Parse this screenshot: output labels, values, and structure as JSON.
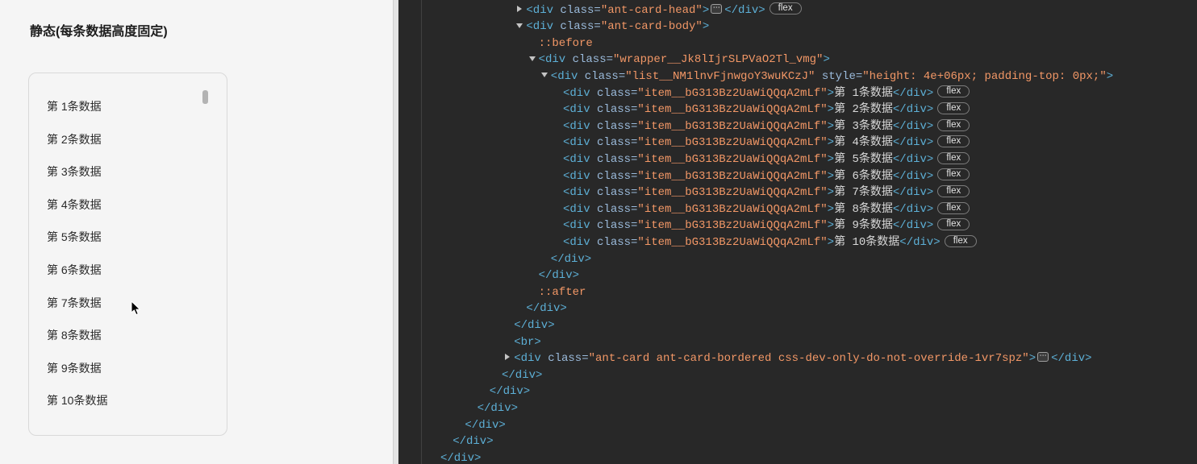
{
  "left_panel": {
    "title": "静态(每条数据高度固定)",
    "list": {
      "scroll_fraction": 0,
      "items": [
        "第 1条数据",
        "第 2条数据",
        "第 3条数据",
        "第 4条数据",
        "第 5条数据",
        "第 6条数据",
        "第 7条数据",
        "第 8条数据",
        "第 9条数据",
        "第 10条数据"
      ]
    }
  },
  "devtools": {
    "colors": {
      "background": "#282828",
      "tag": "#5db0d7",
      "attribute_name": "#9bbbdc",
      "attribute_value": "#f29766",
      "pseudo_element": "#f29766",
      "text": "#d9d9d9",
      "toggle": "#c4c4c4"
    },
    "lines": [
      {
        "toggle": "collapsed-triangle-icon",
        "tokens": [
          {
            "tag": "<div"
          },
          {
            "attr": " class="
          },
          {
            "value": "\"ant-card-head\""
          },
          {
            "tag": ">"
          },
          {
            "ellipsis": "⋯"
          },
          {
            "tag": "</div>"
          },
          {
            "badge": "flex"
          }
        ]
      },
      {
        "toggle": "expanded-triangle-icon",
        "tokens": [
          {
            "tag": "<div"
          },
          {
            "attr": " class="
          },
          {
            "value": "\"ant-card-body\""
          },
          {
            "tag": ">"
          }
        ]
      },
      {
        "tokens": [
          {
            "pseudo": "::before"
          }
        ]
      },
      {
        "toggle": "expanded-triangle-icon",
        "tokens": [
          {
            "tag": "<div"
          },
          {
            "attr": " class="
          },
          {
            "value": "\"wrapper__Jk8lIjrSLPVaO2Tl_vmg\""
          },
          {
            "tag": ">"
          }
        ]
      },
      {
        "toggle": "expanded-triangle-icon",
        "tokens": [
          {
            "tag": "<div"
          },
          {
            "attr": " class="
          },
          {
            "value": "\"list__NM1lnvFjnwgoY3wuKCzJ\""
          },
          {
            "attr": " style="
          },
          {
            "value": "\"height: 4e+06px; padding-top: 0px;\""
          },
          {
            "tag": ">"
          }
        ]
      },
      {
        "tokens": [
          {
            "tag": "<div"
          },
          {
            "attr": " class="
          },
          {
            "value": "\"item__bG313Bz2UaWiQQqA2mLf\""
          },
          {
            "tag": ">"
          },
          {
            "text": "第 1条数据"
          },
          {
            "tag": "</div>"
          },
          {
            "badge": "flex"
          }
        ]
      },
      {
        "tokens": [
          {
            "tag": "<div"
          },
          {
            "attr": " class="
          },
          {
            "value": "\"item__bG313Bz2UaWiQQqA2mLf\""
          },
          {
            "tag": ">"
          },
          {
            "text": "第 2条数据"
          },
          {
            "tag": "</div>"
          },
          {
            "badge": "flex"
          }
        ]
      },
      {
        "tokens": [
          {
            "tag": "<div"
          },
          {
            "attr": " class="
          },
          {
            "value": "\"item__bG313Bz2UaWiQQqA2mLf\""
          },
          {
            "tag": ">"
          },
          {
            "text": "第 3条数据"
          },
          {
            "tag": "</div>"
          },
          {
            "badge": "flex"
          }
        ]
      },
      {
        "tokens": [
          {
            "tag": "<div"
          },
          {
            "attr": " class="
          },
          {
            "value": "\"item__bG313Bz2UaWiQQqA2mLf\""
          },
          {
            "tag": ">"
          },
          {
            "text": "第 4条数据"
          },
          {
            "tag": "</div>"
          },
          {
            "badge": "flex"
          }
        ]
      },
      {
        "tokens": [
          {
            "tag": "<div"
          },
          {
            "attr": " class="
          },
          {
            "value": "\"item__bG313Bz2UaWiQQqA2mLf\""
          },
          {
            "tag": ">"
          },
          {
            "text": "第 5条数据"
          },
          {
            "tag": "</div>"
          },
          {
            "badge": "flex"
          }
        ]
      },
      {
        "tokens": [
          {
            "tag": "<div"
          },
          {
            "attr": " class="
          },
          {
            "value": "\"item__bG313Bz2UaWiQQqA2mLf\""
          },
          {
            "tag": ">"
          },
          {
            "text": "第 6条数据"
          },
          {
            "tag": "</div>"
          },
          {
            "badge": "flex"
          }
        ]
      },
      {
        "tokens": [
          {
            "tag": "<div"
          },
          {
            "attr": " class="
          },
          {
            "value": "\"item__bG313Bz2UaWiQQqA2mLf\""
          },
          {
            "tag": ">"
          },
          {
            "text": "第 7条数据"
          },
          {
            "tag": "</div>"
          },
          {
            "badge": "flex"
          }
        ]
      },
      {
        "tokens": [
          {
            "tag": "<div"
          },
          {
            "attr": " class="
          },
          {
            "value": "\"item__bG313Bz2UaWiQQqA2mLf\""
          },
          {
            "tag": ">"
          },
          {
            "text": "第 8条数据"
          },
          {
            "tag": "</div>"
          },
          {
            "badge": "flex"
          }
        ]
      },
      {
        "tokens": [
          {
            "tag": "<div"
          },
          {
            "attr": " class="
          },
          {
            "value": "\"item__bG313Bz2UaWiQQqA2mLf\""
          },
          {
            "tag": ">"
          },
          {
            "text": "第 9条数据"
          },
          {
            "tag": "</div>"
          },
          {
            "badge": "flex"
          }
        ]
      },
      {
        "tokens": [
          {
            "tag": "<div"
          },
          {
            "attr": " class="
          },
          {
            "value": "\"item__bG313Bz2UaWiQQqA2mLf\""
          },
          {
            "tag": ">"
          },
          {
            "text": "第 10条数据"
          },
          {
            "tag": "</div>"
          },
          {
            "badge": "flex"
          }
        ]
      },
      {
        "tokens": [
          {
            "tag": "</div>"
          }
        ]
      },
      {
        "tokens": [
          {
            "tag": "</div>"
          }
        ]
      },
      {
        "tokens": [
          {
            "pseudo": "::after"
          }
        ]
      },
      {
        "tokens": [
          {
            "tag": "</div>"
          }
        ]
      },
      {
        "tokens": [
          {
            "tag": "</div>"
          }
        ]
      },
      {
        "tokens": [
          {
            "tag": "<br>"
          }
        ]
      },
      {
        "toggle": "collapsed-triangle-icon",
        "tokens": [
          {
            "tag": "<div"
          },
          {
            "attr": " class="
          },
          {
            "value": "\"ant-card ant-card-bordered css-dev-only-do-not-override-1vr7spz\""
          },
          {
            "tag": ">"
          },
          {
            "ellipsis": "⋯"
          },
          {
            "tag": "</div>"
          }
        ]
      },
      {
        "tokens": [
          {
            "tag": "</div>"
          }
        ]
      },
      {
        "tokens": [
          {
            "tag": "</div>"
          }
        ]
      },
      {
        "tokens": [
          {
            "tag": "</div>"
          }
        ]
      },
      {
        "tokens": [
          {
            "tag": "</div>"
          }
        ]
      },
      {
        "tokens": [
          {
            "tag": "</div>"
          }
        ]
      },
      {
        "tokens": [
          {
            "tag": "</div>"
          }
        ]
      }
    ]
  }
}
